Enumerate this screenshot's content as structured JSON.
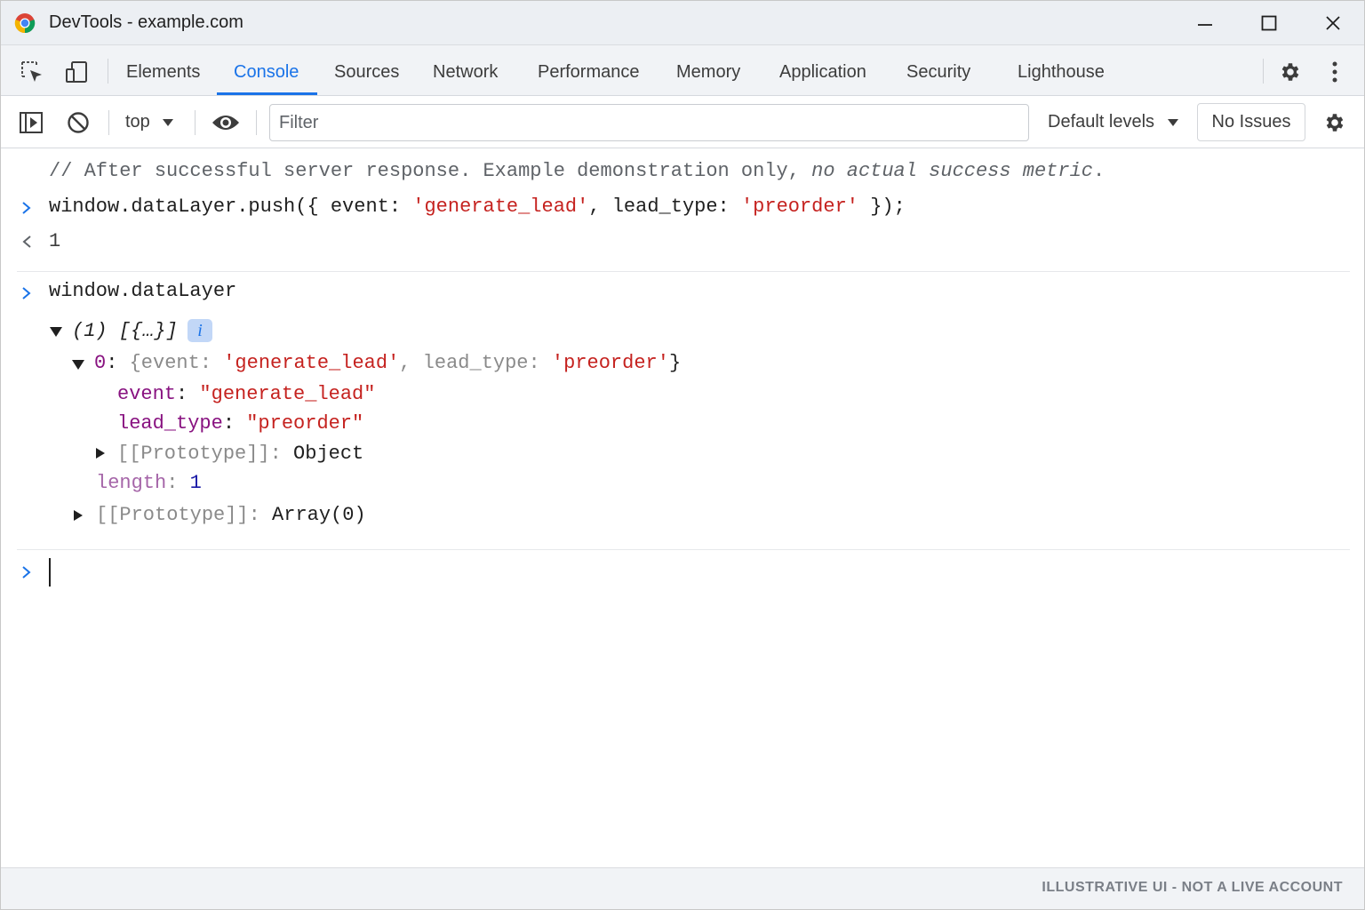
{
  "window": {
    "title": "DevTools - example.com"
  },
  "tabs": [
    "Elements",
    "Console",
    "Sources",
    "Network",
    "Performance",
    "Memory",
    "Application",
    "Security",
    "Lighthouse"
  ],
  "active_tab": "Console",
  "toolbar": {
    "context": "top",
    "filter_placeholder": "Filter",
    "levels": "Default levels",
    "issues": "No Issues"
  },
  "console": {
    "comment_lead": "// After successful server response. Example demonstration only, ",
    "comment_italic": "no actual success metric",
    "comment_end": ".",
    "cmd1": {
      "p1": "window.dataLayer.push({ event: ",
      "s1": "'generate_lead'",
      "p2": ", lead_type: ",
      "s2": "'preorder'",
      "p3": " });"
    },
    "result1": "1",
    "cmd2": "window.dataLayer",
    "array_summary": "(1) [{…}]",
    "info_badge": "i",
    "item": {
      "index": "0",
      "sep": ": ",
      "preview_open": "{event: ",
      "preview_s1": "'generate_lead'",
      "preview_mid": ", lead_type: ",
      "preview_s2": "'preorder'",
      "preview_close": "}"
    },
    "props": [
      {
        "key": "event",
        "value": "\"generate_lead\""
      },
      {
        "key": "lead_type",
        "value": "\"preorder\""
      }
    ],
    "obj_proto_key": "[[Prototype]]",
    "obj_proto_val": "Object",
    "length_key": "length",
    "length_val": "1",
    "arr_proto_key": "[[Prototype]]",
    "arr_proto_val": "Array(0)"
  },
  "footer": "ILLUSTRATIVE UI - NOT A LIVE ACCOUNT",
  "colors": {
    "accent": "#1a73e8",
    "string": "#c5221f",
    "key": "#881280",
    "number": "#1a1aa6"
  }
}
